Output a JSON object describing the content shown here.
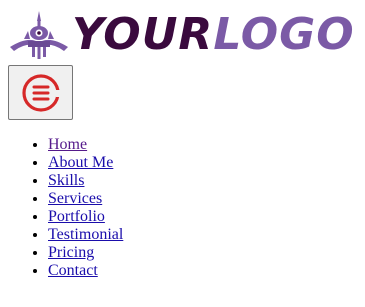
{
  "logo": {
    "text_part1": "YOUR",
    "text_part2": "LOGO",
    "icon": "temple-emblem-icon",
    "colors": {
      "dark": "#3a0a3e",
      "light": "#7b5aa6"
    }
  },
  "menu_button": {
    "icon": "hamburger-circle-icon",
    "color": "#d62828"
  },
  "nav": {
    "items": [
      {
        "label": "Home",
        "visited": true
      },
      {
        "label": "About Me",
        "visited": false
      },
      {
        "label": "Skills",
        "visited": false
      },
      {
        "label": "Services",
        "visited": false
      },
      {
        "label": "Portfolio",
        "visited": false
      },
      {
        "label": "Testimonial",
        "visited": false
      },
      {
        "label": "Pricing",
        "visited": false
      },
      {
        "label": "Contact",
        "visited": false
      }
    ]
  }
}
